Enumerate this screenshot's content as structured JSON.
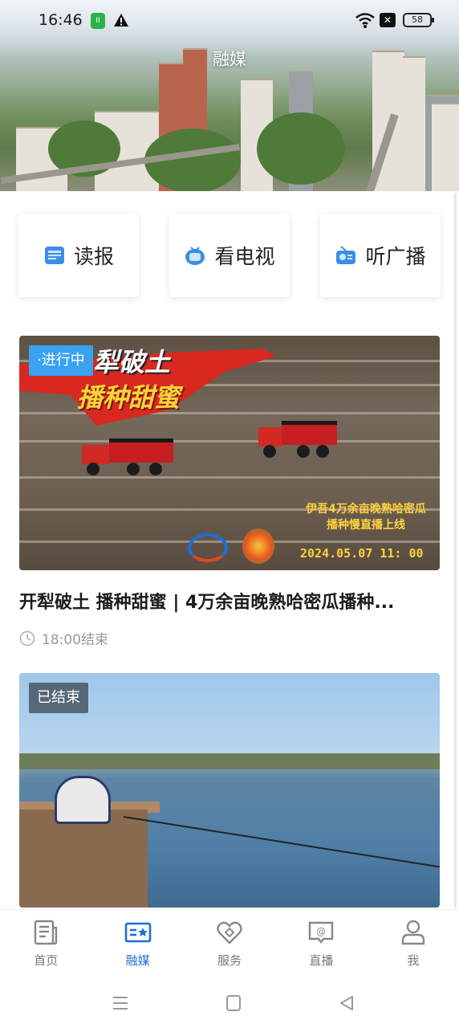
{
  "status_bar": {
    "time": "16:46",
    "battery": "58"
  },
  "header": {
    "title": "融媒"
  },
  "quick_entries": [
    {
      "label": "读报",
      "icon": "newspaper-icon"
    },
    {
      "label": "看电视",
      "icon": "tv-icon"
    },
    {
      "label": "听广播",
      "icon": "radio-icon"
    }
  ],
  "feed": [
    {
      "badge": "·进行中",
      "poster_title_line1": "犁破土",
      "poster_title_line2": "播种甜蜜",
      "poster_note": "伊吾4万余亩晚熟哈密瓜播种慢直播上线",
      "poster_date": "2024.05.07 11: 00",
      "title": "开犁破土 播种甜蜜 | 4万余亩晚熟哈密瓜播种...",
      "meta": "18:00结束"
    },
    {
      "badge": "已结束"
    }
  ],
  "tabbar": {
    "items": [
      {
        "label": "首页",
        "icon": "home-news-icon",
        "active": false
      },
      {
        "label": "融媒",
        "icon": "media-card-icon",
        "active": true
      },
      {
        "label": "服务",
        "icon": "heart-service-icon",
        "active": false
      },
      {
        "label": "直播",
        "icon": "live-chat-icon",
        "active": false
      },
      {
        "label": "我",
        "icon": "user-icon",
        "active": false
      }
    ]
  },
  "colors": {
    "accent": "#1d6ed1",
    "live_badge": "#3aa3f1",
    "inactive_tab": "#777777"
  }
}
